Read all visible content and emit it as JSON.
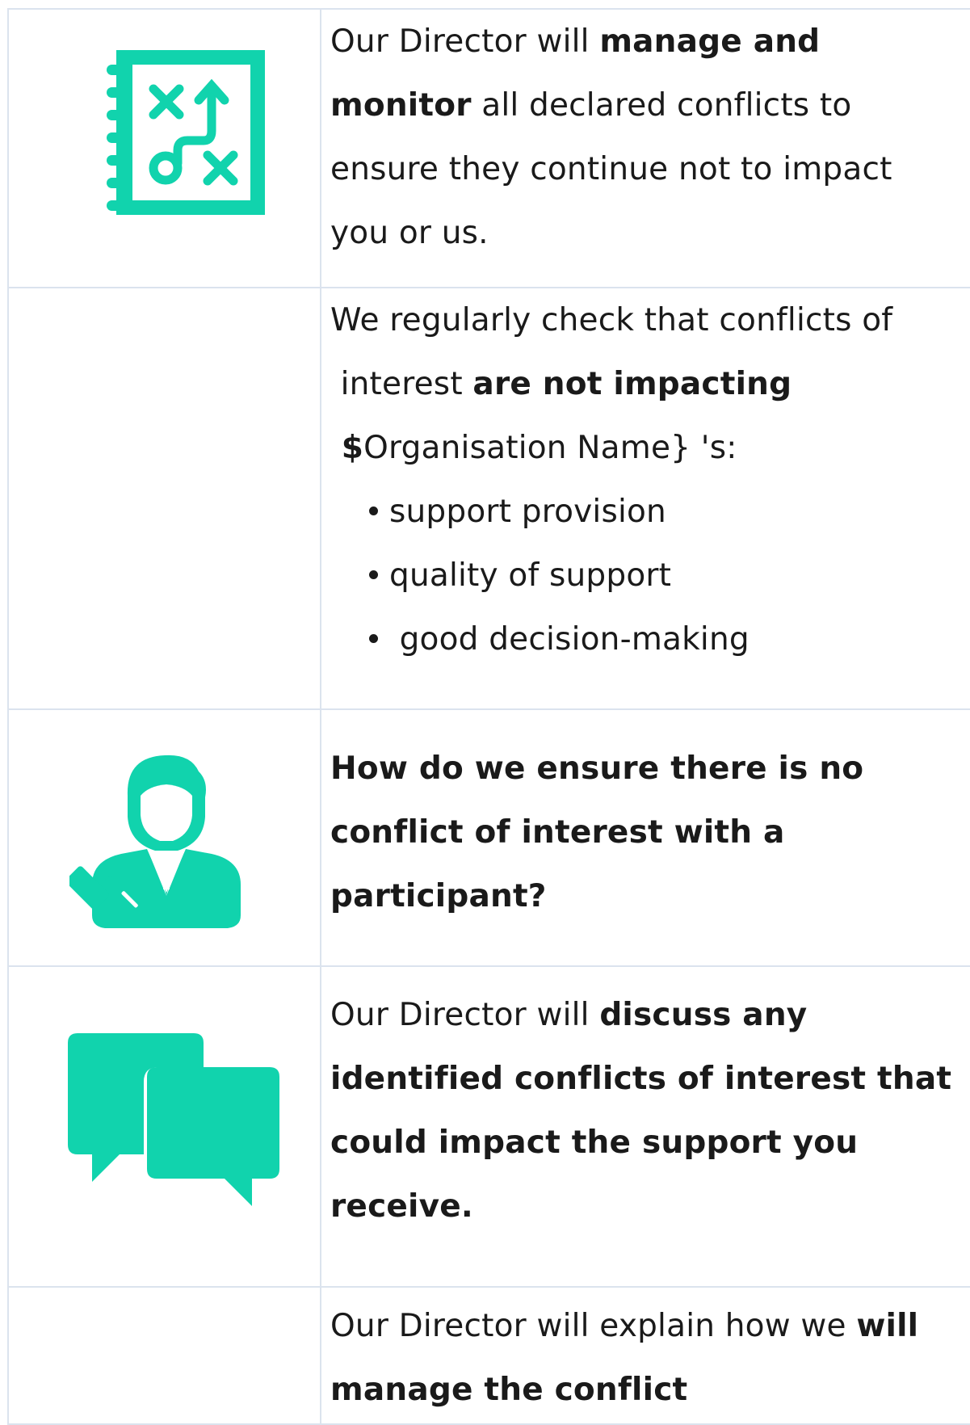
{
  "accent_color": "#11d3ad",
  "rows": [
    {
      "icon": "strategy-plan-icon",
      "lines": [
        [
          {
            "t": "Our Director will ",
            "b": false
          },
          {
            "t": "manage and",
            "b": true
          }
        ],
        [
          {
            "t": "monitor",
            "b": true
          },
          {
            "t": " all declared conflicts to",
            "b": false
          }
        ],
        [
          {
            "t": "ensure they continue not to impact",
            "b": false
          }
        ],
        [
          {
            "t": "you or us.",
            "b": false
          }
        ]
      ]
    },
    {
      "icon": "",
      "lines": [
        [
          {
            "t": "We regularly check that conflicts of",
            "b": false
          }
        ],
        [
          {
            "t": " interest ",
            "b": false
          },
          {
            "t": "are not impacting",
            "b": true
          }
        ],
        [
          {
            "t": " $",
            "b": true
          },
          {
            "t": "Organisation Name} 's:",
            "b": false
          }
        ]
      ],
      "bullets": [
        "support provision",
        "quality of support",
        " good decision-making"
      ]
    },
    {
      "icon": "judge-person-icon",
      "lines": [
        [
          {
            "t": "How do we ensure there is no",
            "b": true
          }
        ],
        [
          {
            "t": "conflict of interest with a",
            "b": true
          }
        ],
        [
          {
            "t": "participant?",
            "b": true
          }
        ]
      ]
    },
    {
      "icon": "chat-bubbles-icon",
      "lines": [
        [
          {
            "t": "Our Director will ",
            "b": false
          },
          {
            "t": "discuss any",
            "b": true
          }
        ],
        [
          {
            "t": "identified conflicts of interest that",
            "b": true
          }
        ],
        [
          {
            "t": "could impact the support you",
            "b": true
          }
        ],
        [
          {
            "t": "receive.",
            "b": true
          }
        ]
      ]
    },
    {
      "icon": "",
      "lines": [
        [
          {
            "t": "Our Director will explain how we ",
            "b": false
          },
          {
            "t": "will",
            "b": true
          }
        ],
        [
          {
            "t": "manage the conflict",
            "b": true
          }
        ]
      ]
    }
  ]
}
